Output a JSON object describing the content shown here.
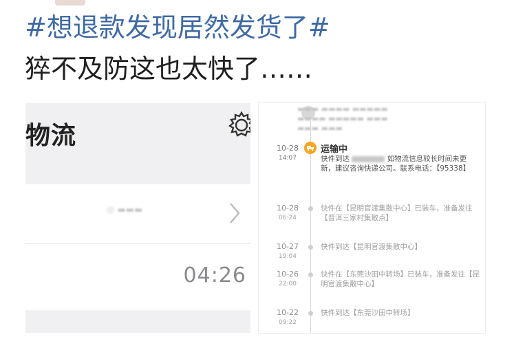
{
  "post": {
    "hashtag": "#想退款发现居然发货了#",
    "caption": "猝不及防这也太快了……"
  },
  "left_screen": {
    "title": "物流",
    "time": "04:26"
  },
  "right_screen": {
    "events": [
      {
        "date": "10-28",
        "time": "14:07",
        "status": "运输中",
        "text_prefix": "快件到达",
        "text_suffix": "如物流信息较长时间未更新，建议咨询快递公司。联系电话：【95338】",
        "active": true
      },
      {
        "date": "10-28",
        "time": "06:24",
        "text": "快件在【昆明官渡集散中心】已装车，准备发往【普洱三家村集散点】"
      },
      {
        "date": "10-27",
        "time": "19:04",
        "text": "快件到达【昆明官渡集散中心】"
      },
      {
        "date": "10-26",
        "time": "22:00",
        "text": "快件在【东莞沙田中转场】已装车，准备发往【昆明官渡集散中心】"
      },
      {
        "date": "10-22",
        "time": "09:22",
        "text": "快件到达【东莞沙田中转场】"
      }
    ]
  },
  "colors": {
    "hashtag": "#3f6aa3",
    "accent_orange": "#f5a623"
  },
  "icons": {
    "settings": "gear-icon",
    "chevron": "chevron-right-icon",
    "truck": "truck-icon"
  }
}
